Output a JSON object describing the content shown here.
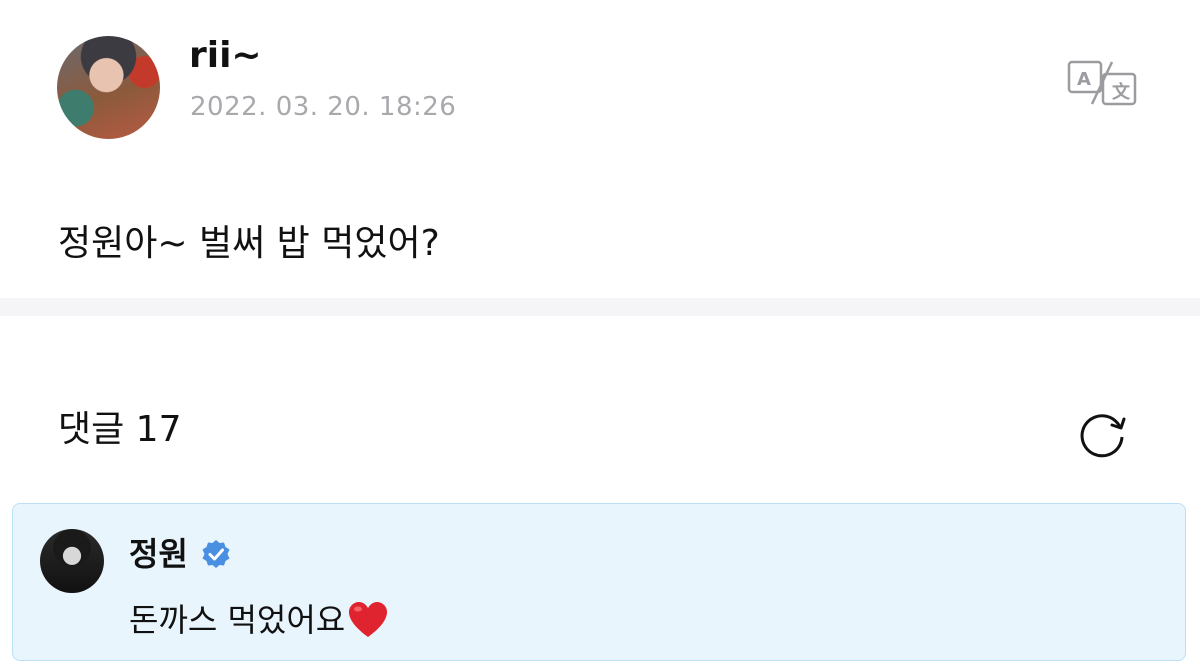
{
  "post": {
    "username": "rii~",
    "timestamp": "2022. 03. 20. 18:26",
    "text": "정원아~ 벌써 밥 먹었어?",
    "translate_icon": "translate-icon"
  },
  "comments": {
    "title": "댓글 17",
    "refresh_icon": "refresh-icon",
    "items": [
      {
        "name": "정원",
        "verified": true,
        "text": "돈까스 먹었어요",
        "emoji": "heart-icon"
      }
    ]
  },
  "colors": {
    "timestamp": "#a9a9ad",
    "comment_bg": "#e9f5fd",
    "comment_border": "#b9e0f6",
    "verified": "#4a90e2",
    "heart": "#e0242f"
  }
}
